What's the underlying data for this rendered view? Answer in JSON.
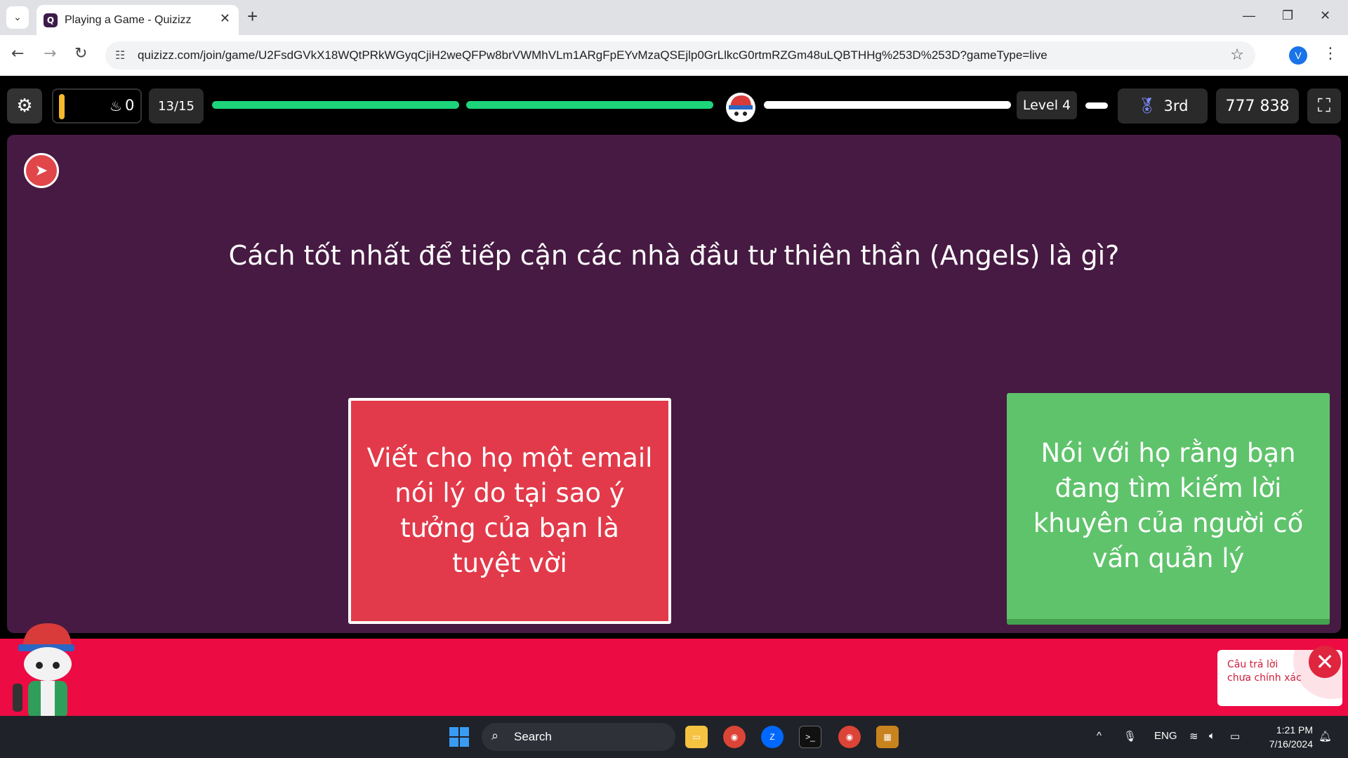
{
  "browser": {
    "tab_title": "Playing a Game - Quizizz",
    "url": "quizizz.com/join/game/U2FsdGVkX18WQtPRkWGyqCjiH2weQFPw8brVWMhVLm1ARgFpEYvMzaQSEjlp0GrLlkcG0rtmRZGm48uLQBTHHg%253D%253D?gameType=live",
    "profile_initial": "V"
  },
  "game": {
    "streak_count": "0",
    "question_counter": "13/15",
    "level": "Level 4",
    "rank": "3rd",
    "score": "777 838",
    "colors": {
      "progress": "#1dd47a",
      "panel": "#461a42",
      "wrong": "#ec0b43"
    }
  },
  "question": {
    "text": "Cách tốt nhất để tiếp cận các nhà đầu tư thiên thần (Angels) là gì?",
    "answers": [
      {
        "text": "Viết cho họ một email nói lý do tại sao ý tưởng của bạn là tuyệt vời",
        "state": "selected-wrong",
        "color": "#e23a4a"
      },
      {
        "text": "Nói với họ rằng bạn đang tìm kiếm lời khuyên của người cố vấn quản lý",
        "state": "correct",
        "color": "#5fc36b"
      }
    ]
  },
  "feedback": {
    "message": "Câu trả lời chưa chính xác"
  },
  "taskbar": {
    "search_label": "Search",
    "language": "ENG",
    "time": "1:21 PM",
    "date": "7/16/2024"
  }
}
